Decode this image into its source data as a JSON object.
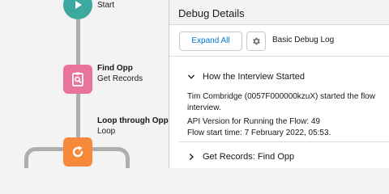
{
  "flow": {
    "start": {
      "label": "Start"
    },
    "get_records": {
      "title": "Find Opp",
      "type": "Get Records"
    },
    "loop": {
      "title": "Loop through Opps",
      "type": "Loop"
    }
  },
  "panel": {
    "title": "Debug Details",
    "expand_all_label": "Expand All",
    "log_level": "Basic Debug Log",
    "sections": [
      {
        "title": "How the Interview Started",
        "expanded": true,
        "lines": [
          "Tim Combridge (0057F000000kzuX) started the flow interview.",
          "API Version for Running the Flow: 49",
          "Flow start time: 7 February 2022, 05:53."
        ]
      },
      {
        "title": "Get Records: Find Opp",
        "expanded": false
      }
    ]
  },
  "colors": {
    "start_node": "#3ba99f",
    "get_records_node": "#e8749b",
    "loop_node": "#f58b3a",
    "link": "#0176d3"
  },
  "icons": {
    "start": "play-icon",
    "get_records": "search-records-icon",
    "loop": "loop-icon",
    "settings": "gear-icon",
    "expanded": "chevron-down-icon",
    "collapsed": "chevron-right-icon"
  }
}
